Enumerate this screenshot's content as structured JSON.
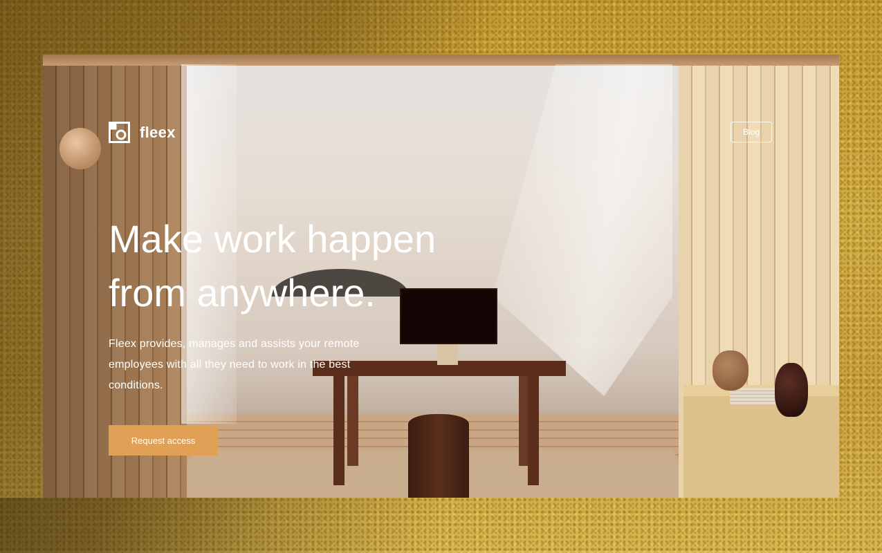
{
  "brand": {
    "name": "fleex",
    "logo_icon": "fleex-logo-icon"
  },
  "nav": {
    "blog_label": "Blog"
  },
  "hero": {
    "headline_line1": "Make work happen",
    "headline_line2": "from anywhere.",
    "description": "Fleex provides, manages and assists your remote employees with all they need to work in the best conditions.",
    "cta_label": "Request access"
  },
  "colors": {
    "accent": "#e0a055",
    "text": "#ffffff",
    "background_wall": "#c9a43a"
  }
}
